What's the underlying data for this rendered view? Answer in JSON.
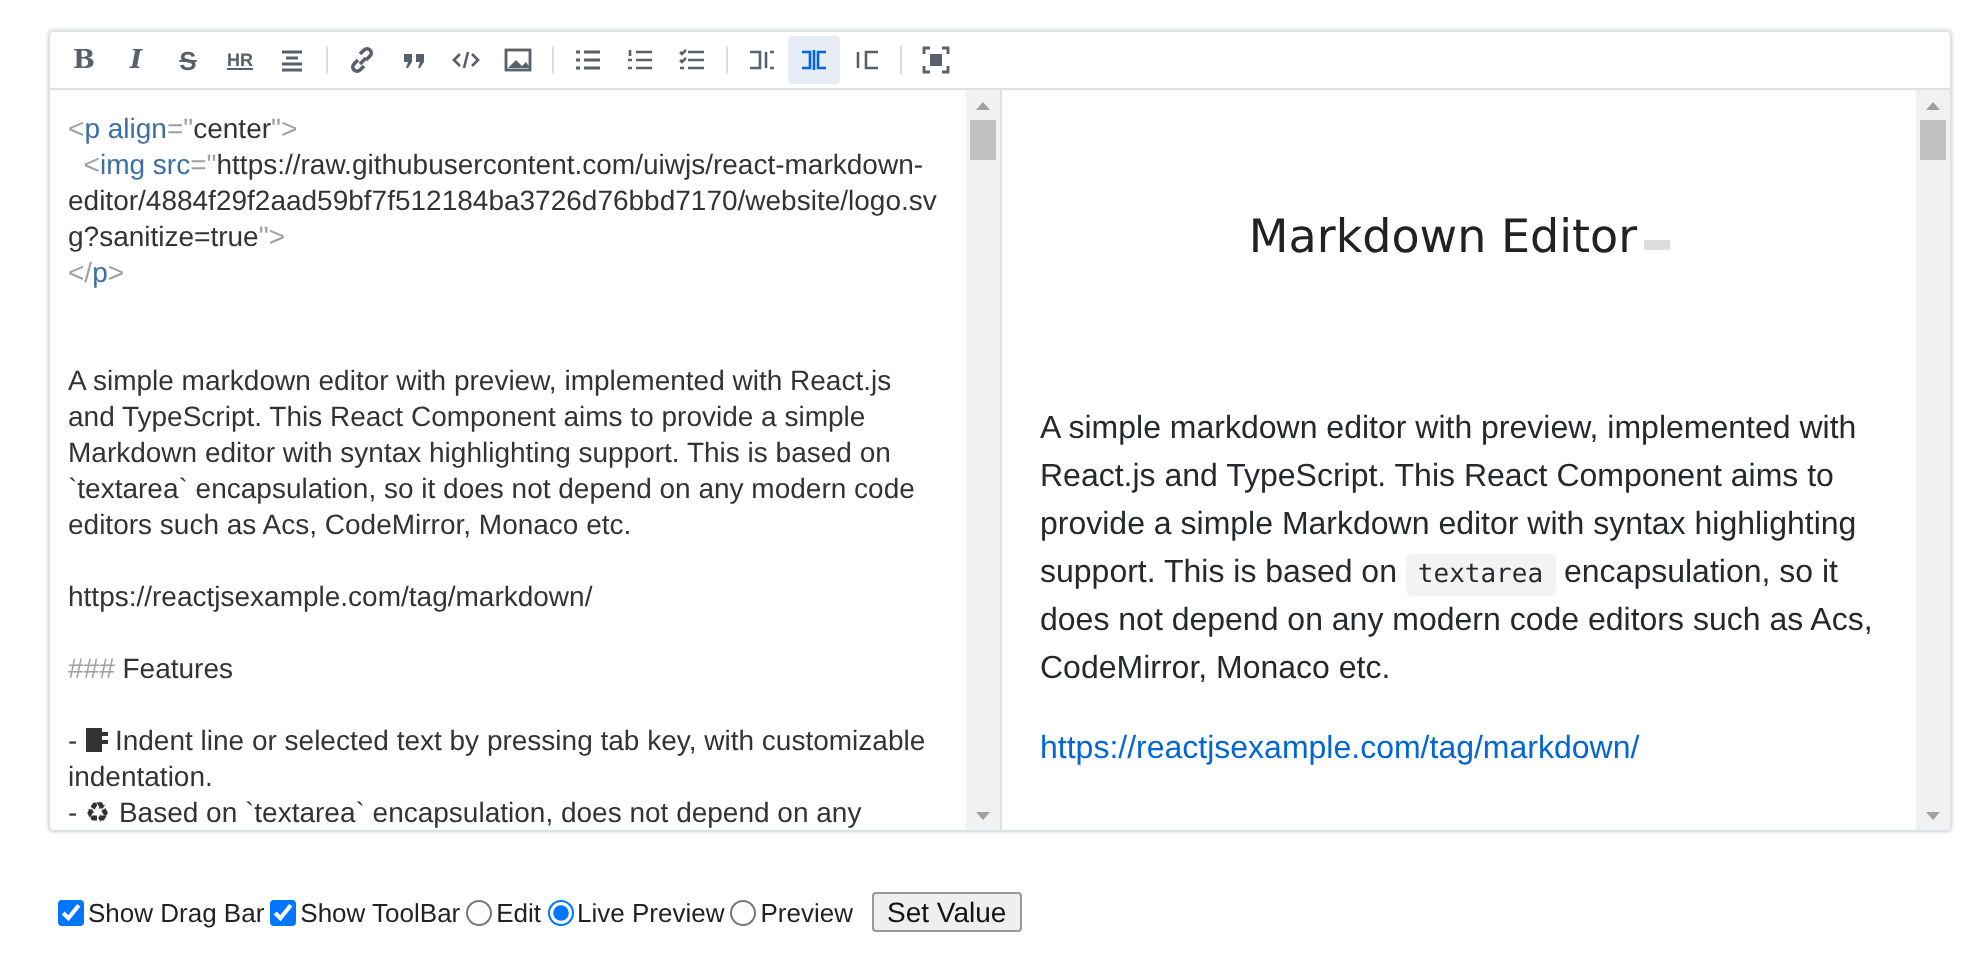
{
  "toolbar": {
    "groups": [
      [
        {
          "kind": "bold",
          "label": "B",
          "selected": false
        },
        {
          "kind": "italic",
          "label": "I",
          "selected": false
        },
        {
          "kind": "strike",
          "label": "S",
          "selected": false
        },
        {
          "kind": "hr",
          "label": "HR",
          "selected": false
        },
        {
          "kind": "title",
          "selected": false
        }
      ],
      [
        {
          "kind": "link",
          "selected": false
        },
        {
          "kind": "quote",
          "selected": false
        },
        {
          "kind": "code",
          "selected": false
        },
        {
          "kind": "image",
          "selected": false
        }
      ],
      [
        {
          "kind": "ul",
          "selected": false
        },
        {
          "kind": "ol",
          "selected": false
        },
        {
          "kind": "todo",
          "selected": false
        }
      ],
      [
        {
          "kind": "edit",
          "selected": false
        },
        {
          "kind": "live",
          "selected": true
        },
        {
          "kind": "preview",
          "selected": false
        }
      ],
      [
        {
          "kind": "fullscreen",
          "selected": false
        }
      ]
    ]
  },
  "editor": {
    "blocks": [
      [
        {
          "tokens": [
            {
              "kind": "punct",
              "text": "<"
            },
            {
              "kind": "tag",
              "text": "p align"
            },
            {
              "kind": "punct",
              "text": "=\""
            },
            {
              "kind": "text",
              "text": "center"
            },
            {
              "kind": "punct",
              "text": "\">"
            }
          ]
        },
        {
          "tokens": [
            {
              "kind": "punct",
              "text": "  <"
            },
            {
              "kind": "tag",
              "text": "img src"
            },
            {
              "kind": "punct",
              "text": "=\""
            },
            {
              "kind": "text",
              "text": "https://raw.githubusercontent.com/uiwjs/react-markdown-editor/4884f29f2aad59bf7f512184ba3726d76bbd7170/website/logo.svg?sanitize=true"
            },
            {
              "kind": "punct",
              "text": "\">"
            }
          ]
        },
        {
          "tokens": [
            {
              "kind": "punct",
              "text": "</"
            },
            {
              "kind": "tag",
              "text": "p"
            },
            {
              "kind": "punct",
              "text": ">"
            }
          ]
        }
      ],
      [
        {
          "tokens": [
            {
              "kind": "text",
              "text": "A simple markdown editor with preview, implemented with React.js and TypeScript. This React Component aims to provide a simple Markdown editor with syntax highlighting support. This is based on `textarea` encapsulation, so it does not depend on any modern code editors such as Acs, CodeMirror, Monaco etc."
            }
          ]
        }
      ],
      [
        {
          "tokens": [
            {
              "kind": "text",
              "text": "https://reactjsexample.com/tag/markdown/"
            }
          ]
        }
      ],
      [
        {
          "tokens": [
            {
              "kind": "punct",
              "text": "###"
            },
            {
              "kind": "text",
              "text": " Features"
            }
          ]
        }
      ],
      [
        {
          "tokens": [
            {
              "kind": "text",
              "text": "- "
            },
            {
              "kind": "icon"
            },
            {
              "kind": "text",
              "text": " Indent line or selected text by pressing tab key, with customizable indentation."
            }
          ]
        },
        {
          "tokens": [
            {
              "kind": "text",
              "text": "- ♻ Based on `textarea` encapsulation, does not depend on any"
            }
          ]
        }
      ]
    ]
  },
  "preview": {
    "logo": "Markdown Editor",
    "blocks": [
      {
        "kind": "paragraph",
        "parts": [
          {
            "kind": "text",
            "text": "A simple markdown editor with preview, implemented with React.js and TypeScript. This React Component aims to provide a simple Markdown editor with syntax highlighting support. This is based on "
          },
          {
            "kind": "code",
            "text": "textarea"
          },
          {
            "kind": "text",
            "text": " encapsulation, so it does not depend on any modern code editors such as Acs, CodeMirror, Monaco etc."
          }
        ]
      },
      {
        "kind": "link",
        "text": "https://reactjsexample.com/tag/markdown/"
      }
    ]
  },
  "controls": [
    {
      "kind": "checkbox",
      "label": "Show Drag Bar",
      "checked": true
    },
    {
      "kind": "checkbox",
      "label": "Show ToolBar",
      "checked": true
    },
    {
      "kind": "radio",
      "label": "Edit",
      "selected": false
    },
    {
      "kind": "radio",
      "label": "Live Preview",
      "selected": true
    },
    {
      "kind": "radio",
      "label": "Preview",
      "selected": false
    },
    {
      "kind": "button",
      "label": "Set Value"
    }
  ]
}
